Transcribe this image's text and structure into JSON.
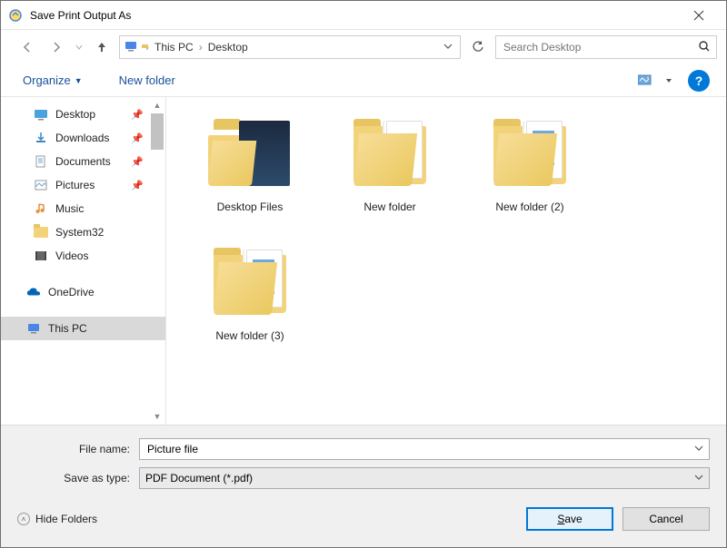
{
  "window": {
    "title": "Save Print Output As"
  },
  "nav": {
    "breadcrumbs": {
      "root": "This PC",
      "current": "Desktop"
    },
    "search_placeholder": "Search Desktop"
  },
  "toolbar": {
    "organize": "Organize",
    "new_folder": "New folder"
  },
  "navpane": {
    "quick": [
      {
        "label": "Desktop",
        "icon": "desktop",
        "pinned": true
      },
      {
        "label": "Downloads",
        "icon": "downloads",
        "pinned": true
      },
      {
        "label": "Documents",
        "icon": "documents",
        "pinned": true
      },
      {
        "label": "Pictures",
        "icon": "pictures",
        "pinned": true
      },
      {
        "label": "Music",
        "icon": "music",
        "pinned": false
      },
      {
        "label": "System32",
        "icon": "folder",
        "pinned": false
      },
      {
        "label": "Videos",
        "icon": "videos",
        "pinned": false
      }
    ],
    "onedrive": "OneDrive",
    "thispc": "This PC"
  },
  "content": {
    "items": [
      {
        "label": "Desktop Files",
        "kind": "desktopfiles"
      },
      {
        "label": "New folder",
        "kind": "folder"
      },
      {
        "label": "New folder (2)",
        "kind": "folder-docs"
      },
      {
        "label": "New folder (3)",
        "kind": "folder-docs"
      }
    ]
  },
  "footer": {
    "file_name_label": "File name:",
    "file_name_value": "Picture file",
    "save_type_label": "Save as type:",
    "save_type_value": "PDF Document (*.pdf)",
    "hide_folders": "Hide Folders",
    "save": "Save",
    "cancel": "Cancel"
  }
}
